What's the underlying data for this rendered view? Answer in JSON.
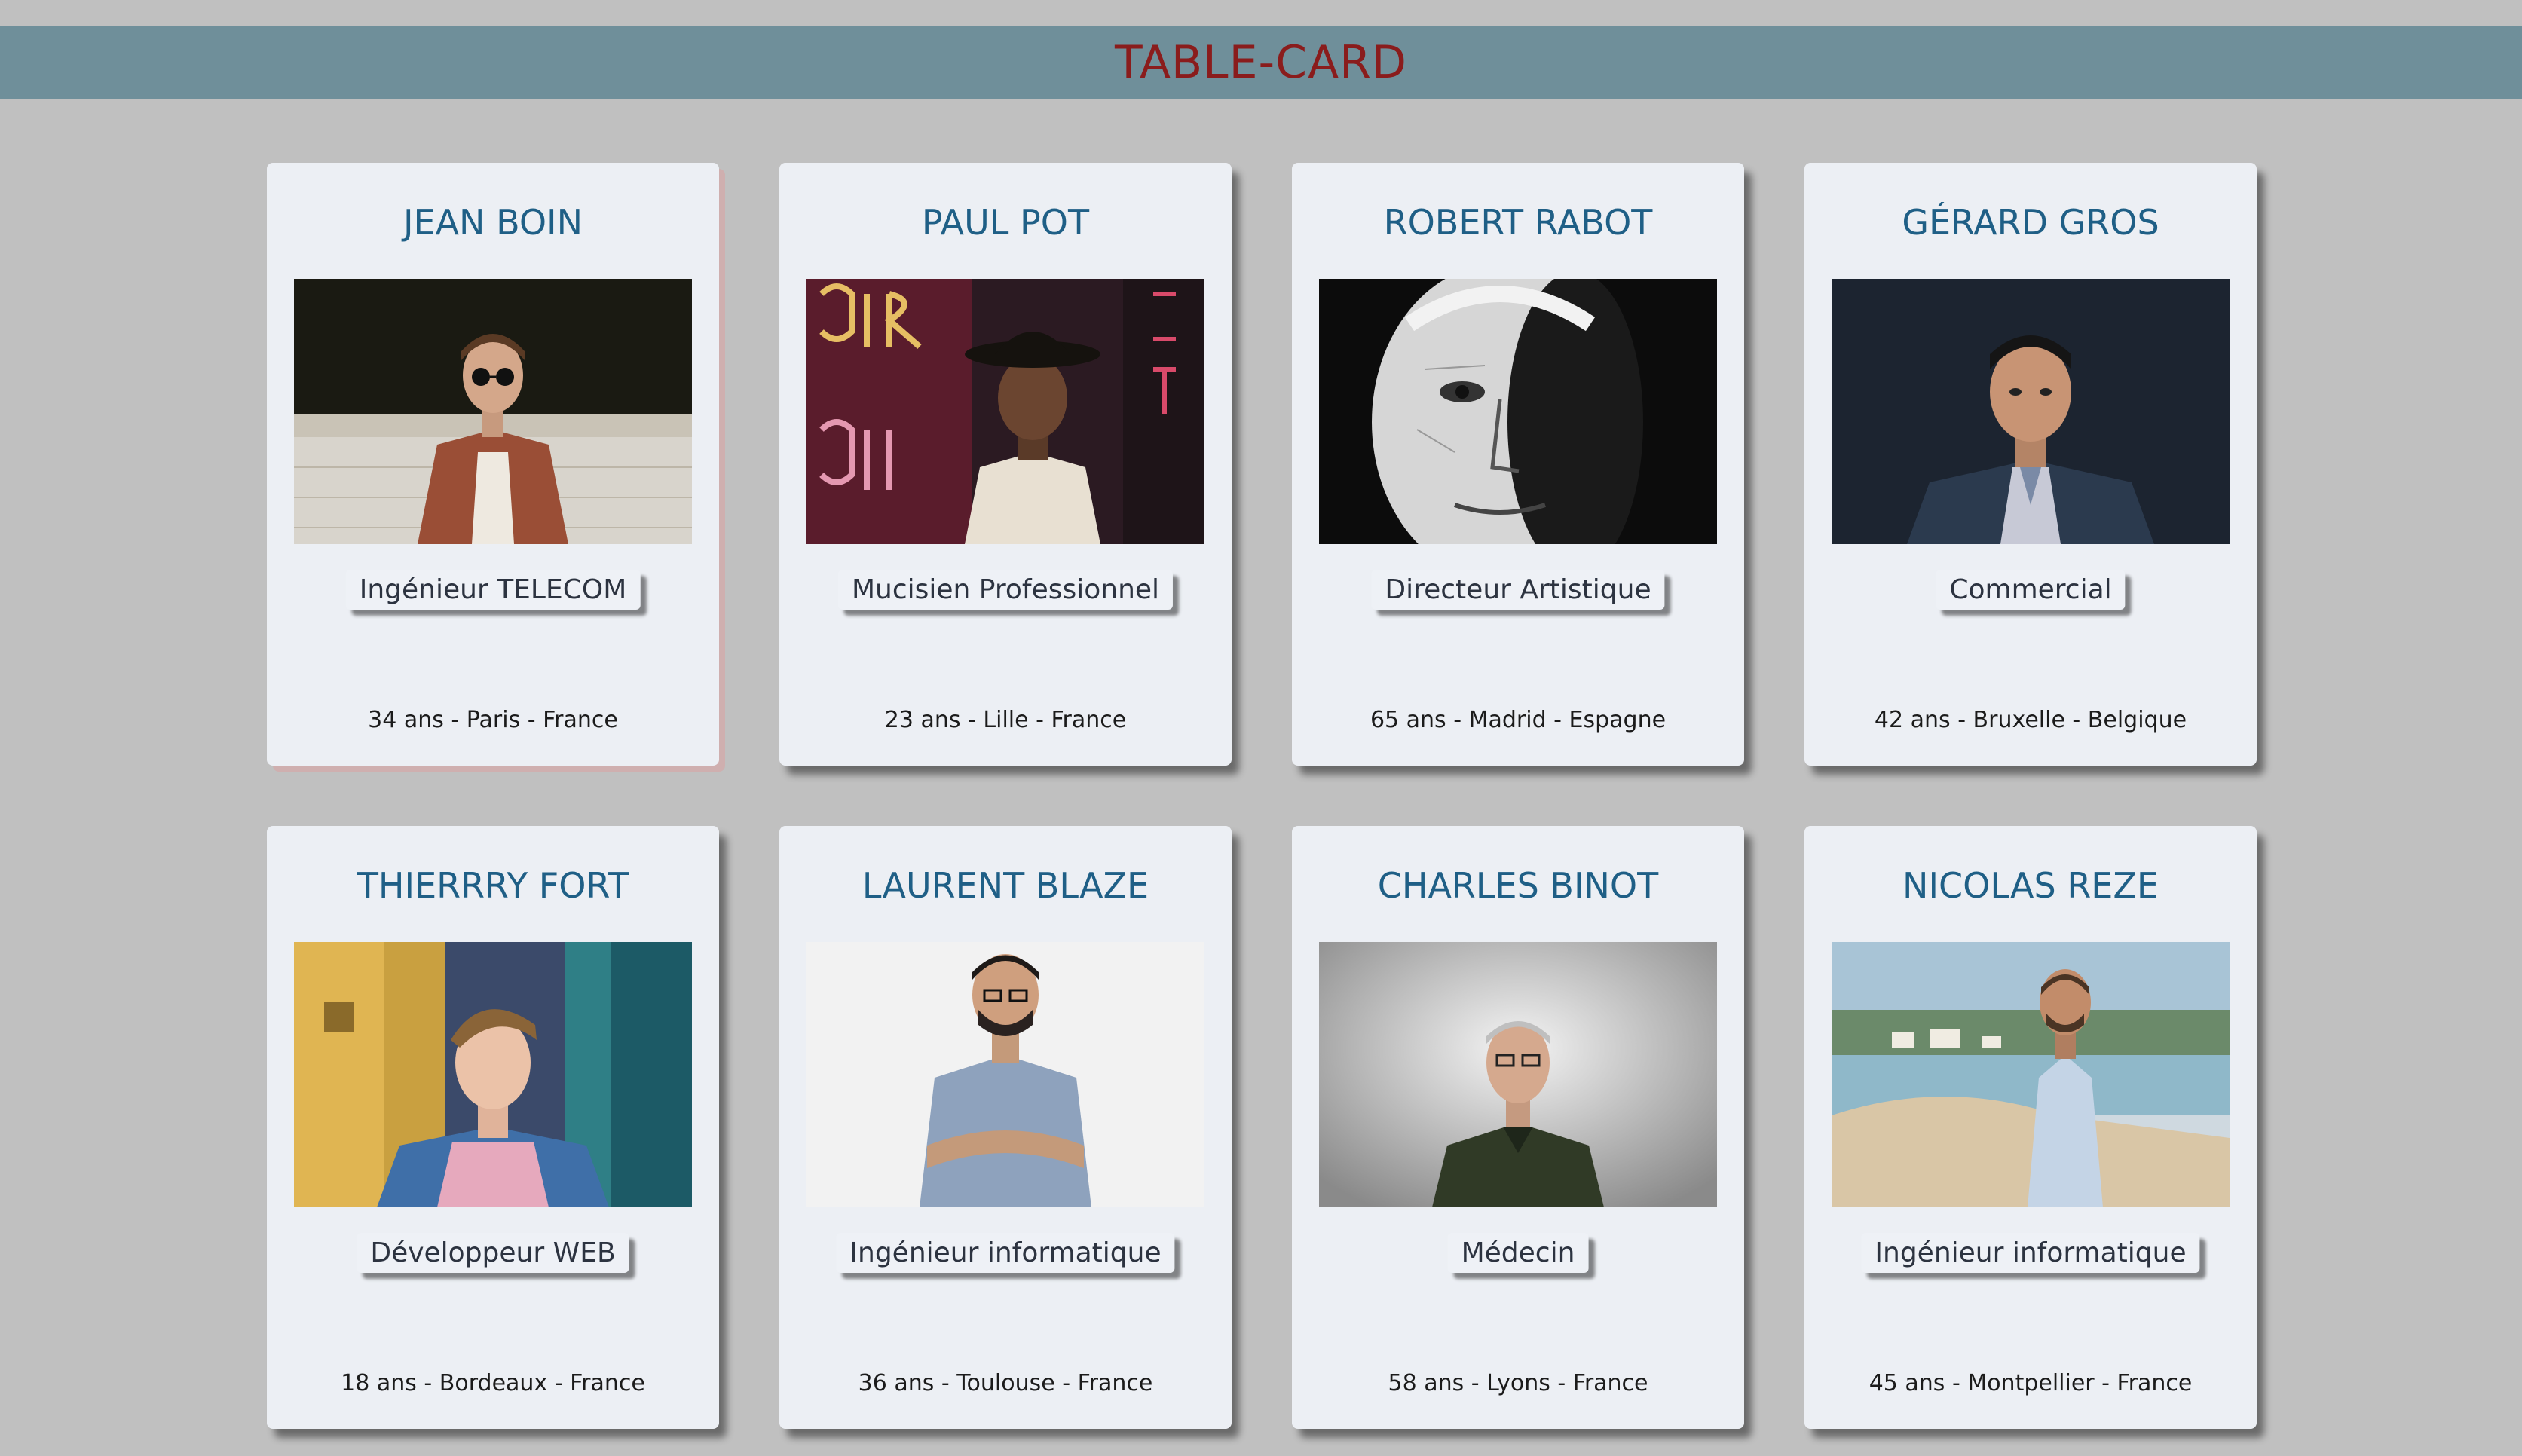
{
  "header": {
    "title": "TABLE-CARD"
  },
  "cards": [
    {
      "name": "JEAN BOIN",
      "job": "Ingénieur TELECOM",
      "info": "34 ans - Paris - France",
      "photo": "portrait-man-sunglasses-brown-jacket"
    },
    {
      "name": "PAUL POT",
      "job": "Mucisien Professionnel",
      "info": "23 ans - Lille - France",
      "photo": "portrait-man-hat-neon-sign"
    },
    {
      "name": "ROBERT RABOT",
      "job": "Directeur Artistique",
      "info": "65 ans - Madrid - Espagne",
      "photo": "portrait-old-man-black-and-white"
    },
    {
      "name": "GÉRARD GROS",
      "job": "Commercial",
      "info": "42 ans - Bruxelle - Belgique",
      "photo": "portrait-man-suit-dark-background"
    },
    {
      "name": "THIERRRY FORT",
      "job": "Développeur WEB",
      "info": "18 ans - Bordeaux - France",
      "photo": "portrait-young-man-denim-jacket"
    },
    {
      "name": "LAURENT BLAZE",
      "job": "Ingénieur informatique",
      "info": "36 ans - Toulouse - France",
      "photo": "portrait-man-glasses-arms-crossed"
    },
    {
      "name": "CHARLES BINOT",
      "job": "Médecin",
      "info": "58 ans - Lyons - France",
      "photo": "portrait-man-glasses-polo-shirt"
    },
    {
      "name": "NICOLAS REZE",
      "job": "Ingénieur informatique",
      "info": "45 ans - Montpellier - France",
      "photo": "portrait-man-beach-shirt"
    }
  ]
}
